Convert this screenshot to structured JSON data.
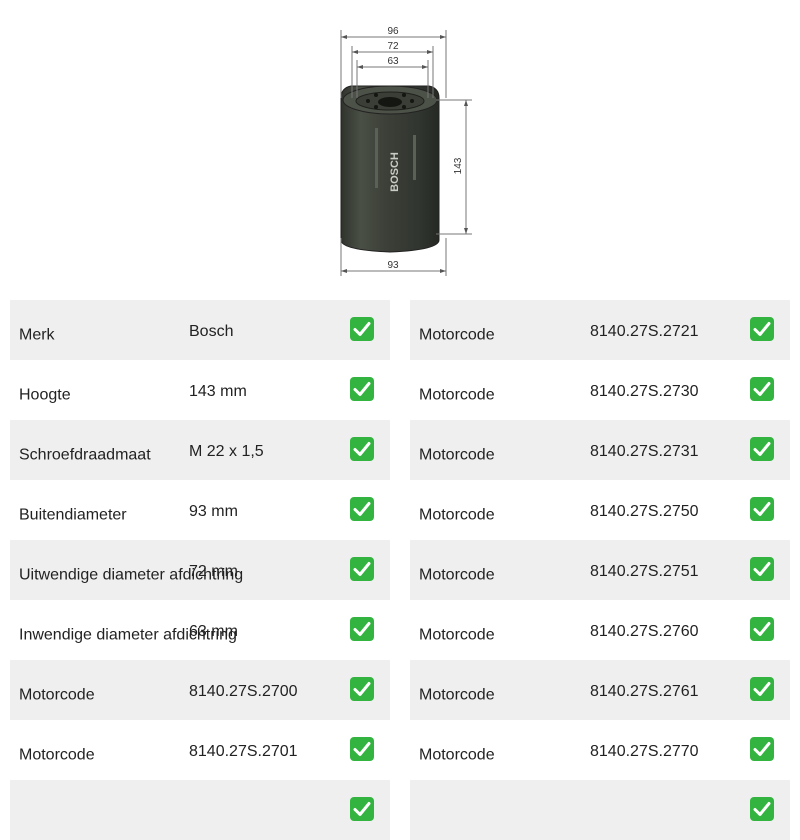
{
  "drawing": {
    "brand": "BOSCH",
    "dimensions": {
      "outer_top": "96",
      "seal_outer": "72",
      "seal_inner": "63",
      "height": "143",
      "outer_bottom": "93"
    }
  },
  "left_table": [
    {
      "label": "Merk",
      "value": "Bosch"
    },
    {
      "label": "Hoogte",
      "value": "143 mm"
    },
    {
      "label": "Schroefdraadmaat",
      "value": "M 22 x 1,5"
    },
    {
      "label": "Buitendiameter",
      "value": "93 mm"
    },
    {
      "label": "Uitwendige diameter afdichtring",
      "value": "72 mm"
    },
    {
      "label": "Inwendige diameter afdichtring",
      "value": "63 mm"
    },
    {
      "label": "Motorcode",
      "value": "8140.27S.2700"
    },
    {
      "label": "Motorcode",
      "value": "8140.27S.2701"
    },
    {
      "label": "",
      "value": ""
    }
  ],
  "right_table": [
    {
      "label": "Motorcode",
      "value": "8140.27S.2721"
    },
    {
      "label": "Motorcode",
      "value": "8140.27S.2730"
    },
    {
      "label": "Motorcode",
      "value": "8140.27S.2731"
    },
    {
      "label": "Motorcode",
      "value": "8140.27S.2750"
    },
    {
      "label": "Motorcode",
      "value": "8140.27S.2751"
    },
    {
      "label": "Motorcode",
      "value": "8140.27S.2760"
    },
    {
      "label": "Motorcode",
      "value": "8140.27S.2761"
    },
    {
      "label": "Motorcode",
      "value": "8140.27S.2770"
    },
    {
      "label": "",
      "value": ""
    }
  ],
  "colors": {
    "row_alt": "#efefef",
    "check_green": "#33b440",
    "filter_body": "#3b3f37"
  }
}
